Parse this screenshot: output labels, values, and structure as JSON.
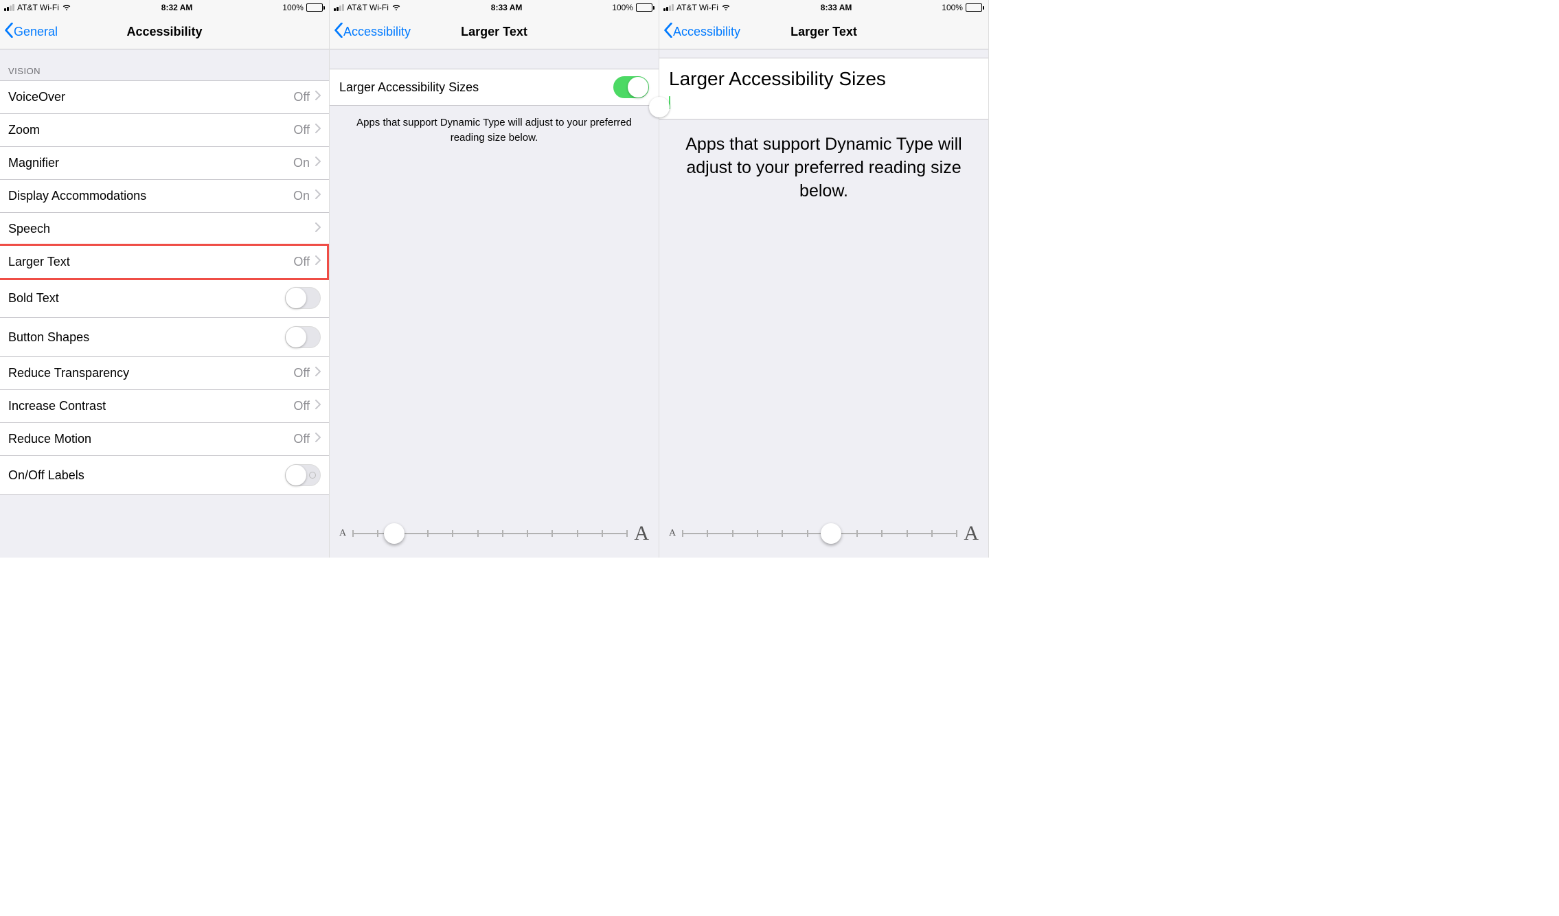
{
  "colors": {
    "accent": "#007aff",
    "toggleOn": "#4cd964",
    "highlight": "#ef4d46"
  },
  "screen1": {
    "status": {
      "carrier": "AT&T Wi-Fi",
      "time": "8:32 AM",
      "battery": "100%"
    },
    "nav": {
      "back": "General",
      "title": "Accessibility"
    },
    "section": "VISION",
    "rows": [
      {
        "label": "VoiceOver",
        "value": "Off",
        "type": "chevron"
      },
      {
        "label": "Zoom",
        "value": "Off",
        "type": "chevron"
      },
      {
        "label": "Magnifier",
        "value": "On",
        "type": "chevron"
      },
      {
        "label": "Display Accommodations",
        "value": "On",
        "type": "chevron"
      },
      {
        "label": "Speech",
        "value": "",
        "type": "chevron"
      },
      {
        "label": "Larger Text",
        "value": "Off",
        "type": "chevron",
        "highlight": true
      },
      {
        "label": "Bold Text",
        "value": "",
        "type": "toggle",
        "on": false
      },
      {
        "label": "Button Shapes",
        "value": "",
        "type": "toggle",
        "on": false
      },
      {
        "label": "Reduce Transparency",
        "value": "Off",
        "type": "chevron"
      },
      {
        "label": "Increase Contrast",
        "value": "Off",
        "type": "chevron"
      },
      {
        "label": "Reduce Motion",
        "value": "Off",
        "type": "chevron"
      },
      {
        "label": "On/Off Labels",
        "value": "",
        "type": "toggle-io",
        "on": false
      }
    ]
  },
  "screen2": {
    "status": {
      "carrier": "AT&T Wi-Fi",
      "time": "8:33 AM",
      "battery": "100%"
    },
    "nav": {
      "back": "Accessibility",
      "title": "Larger Text"
    },
    "toggleLabel": "Larger Accessibility Sizes",
    "toggleOn": true,
    "footer": "Apps that support Dynamic Type will adjust to your preferred reading size below.",
    "slider": {
      "min": "A",
      "max": "A",
      "ticks": 12,
      "thumbPosition": 0.15
    }
  },
  "screen3": {
    "status": {
      "carrier": "AT&T Wi-Fi",
      "time": "8:33 AM",
      "battery": "100%"
    },
    "nav": {
      "back": "Accessibility",
      "title": "Larger Text"
    },
    "toggleLabel": "Larger Accessibility Sizes",
    "toggleOn": true,
    "footer": "Apps that support Dynamic Type will adjust to your preferred reading size below.",
    "slider": {
      "min": "A",
      "max": "A",
      "ticks": 12,
      "thumbPosition": 0.54
    }
  }
}
